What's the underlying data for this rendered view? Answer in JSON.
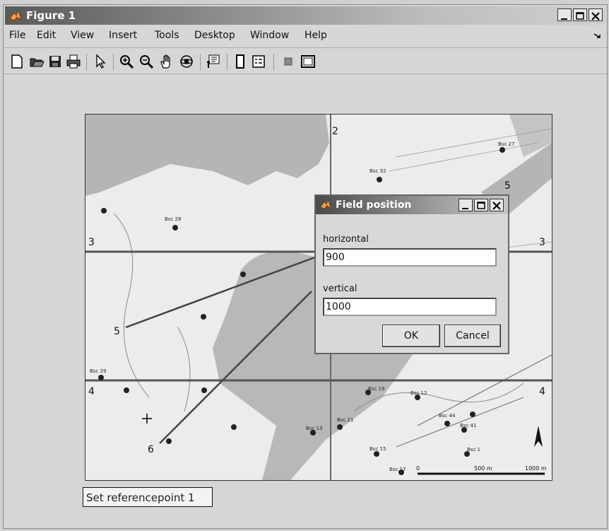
{
  "window": {
    "title": "Figure 1"
  },
  "menubar": {
    "items": [
      "File",
      "Edit",
      "View",
      "Insert",
      "Tools",
      "Desktop",
      "Window",
      "Help"
    ]
  },
  "toolbar": {
    "tools": [
      "new-file-icon",
      "open-file-icon",
      "save-icon",
      "print-icon",
      "pointer-icon",
      "zoom-in-icon",
      "zoom-out-icon",
      "pan-hand-icon",
      "rotate-3d-icon",
      "data-cursor-icon",
      "colorbar-icon",
      "legend-icon",
      "hide-plot-tools-icon",
      "show-plot-tools-icon"
    ]
  },
  "map": {
    "grid_labels": [
      "2",
      "3",
      "3",
      "4",
      "4",
      "5",
      "5",
      "6"
    ],
    "station_labels": [
      "Bsc 27",
      "Bsc 32",
      "Bsc 28",
      "Bsc 29",
      "Bsc 19",
      "Bsc 12",
      "Bsc 13",
      "Bsc 15",
      "Bsc 41",
      "Bsc 44",
      "Bsc 21",
      "Bsc 1",
      "Bsc 17"
    ],
    "scalebar": {
      "start": "0",
      "mid": "500 m",
      "end": "1000 m"
    }
  },
  "status": {
    "text": "Set referencepoint 1"
  },
  "dialog": {
    "title": "Field position",
    "horizontal_label": "horizontal",
    "horizontal_value": "900",
    "vertical_label": "vertical",
    "vertical_value": "1000",
    "ok_label": "OK",
    "cancel_label": "Cancel"
  }
}
